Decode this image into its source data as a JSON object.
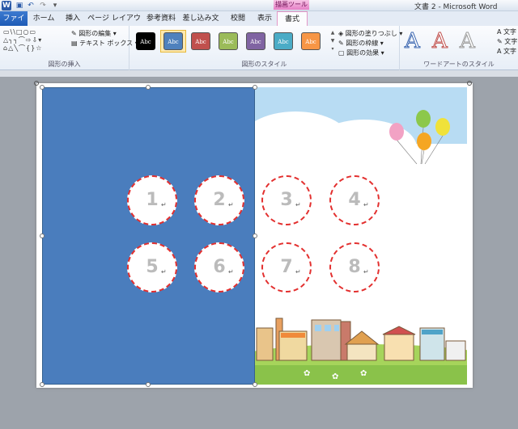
{
  "window": {
    "title": "文書 2 - Microsoft Word",
    "contextual_tab_header": "描画ツール",
    "word_icon": "W"
  },
  "tabs": [
    "ファイル",
    "ホーム",
    "挿入",
    "ページ レイアウト",
    "参考資料",
    "差し込み文書",
    "校閲",
    "表示",
    "書式"
  ],
  "ribbon": {
    "insert_group": {
      "label": "図形の挿入",
      "shape_rows": [
        "▭\\\\□○▭",
        "△╮┐⌒⇨⇩▾",
        "⌂△╲⌒{}☆"
      ],
      "edit_shape": "図形の編集 ▾",
      "text_box": "テキスト ボックス ▾"
    },
    "styles_group": {
      "label": "図形のスタイル",
      "swatch_text": "Abc",
      "swatches": [
        "#000000",
        "#4f81bd",
        "#c0504d",
        "#9bbb59",
        "#8064a2",
        "#4bacc6",
        "#f79646"
      ],
      "selected_index": 1,
      "fill": "図形の塗りつぶし ▾",
      "outline": "図形の枠線 ▾",
      "effects": "図形の効果 ▾"
    },
    "wordart_group": {
      "label": "ワードアートのスタイル",
      "letters": [
        "A",
        "A",
        "A"
      ],
      "cmd1": "文字",
      "cmd2": "文字",
      "cmd3": "文字"
    }
  },
  "document": {
    "circles": [
      "1",
      "2",
      "3",
      "4",
      "5",
      "6",
      "7",
      "8"
    ],
    "paragraph_mark": "↵",
    "panel_color": "#4a7dbd",
    "circle_border_color": "#e3302f"
  }
}
